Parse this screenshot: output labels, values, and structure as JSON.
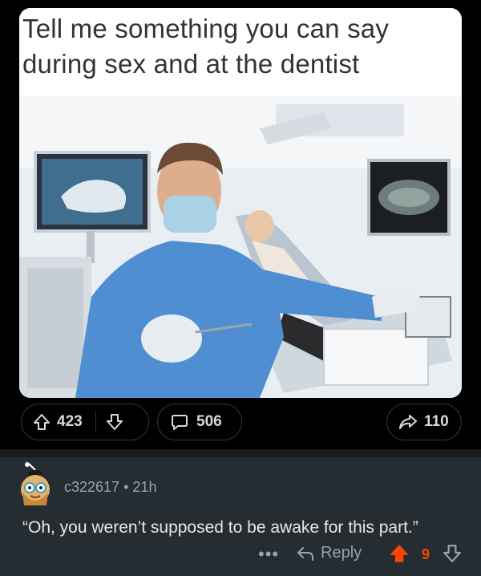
{
  "meme": {
    "caption_line1": "Tell me something you can say",
    "caption_line2": "during sex and at the dentist"
  },
  "post_actions": {
    "upvotes": "423",
    "comments": "506",
    "shares": "110"
  },
  "comment": {
    "username": "c322617",
    "separator": "•",
    "age": "21h",
    "body": "“Oh, you weren’t supposed to be awake for this part.”",
    "more": "•••",
    "reply_label": "Reply",
    "score": "9"
  },
  "colors": {
    "background": "#000000",
    "comment_background": "#252d33",
    "upvote_active": "#ff4500",
    "text_primary": "#d7dadc",
    "text_secondary": "#9aa3ad"
  }
}
